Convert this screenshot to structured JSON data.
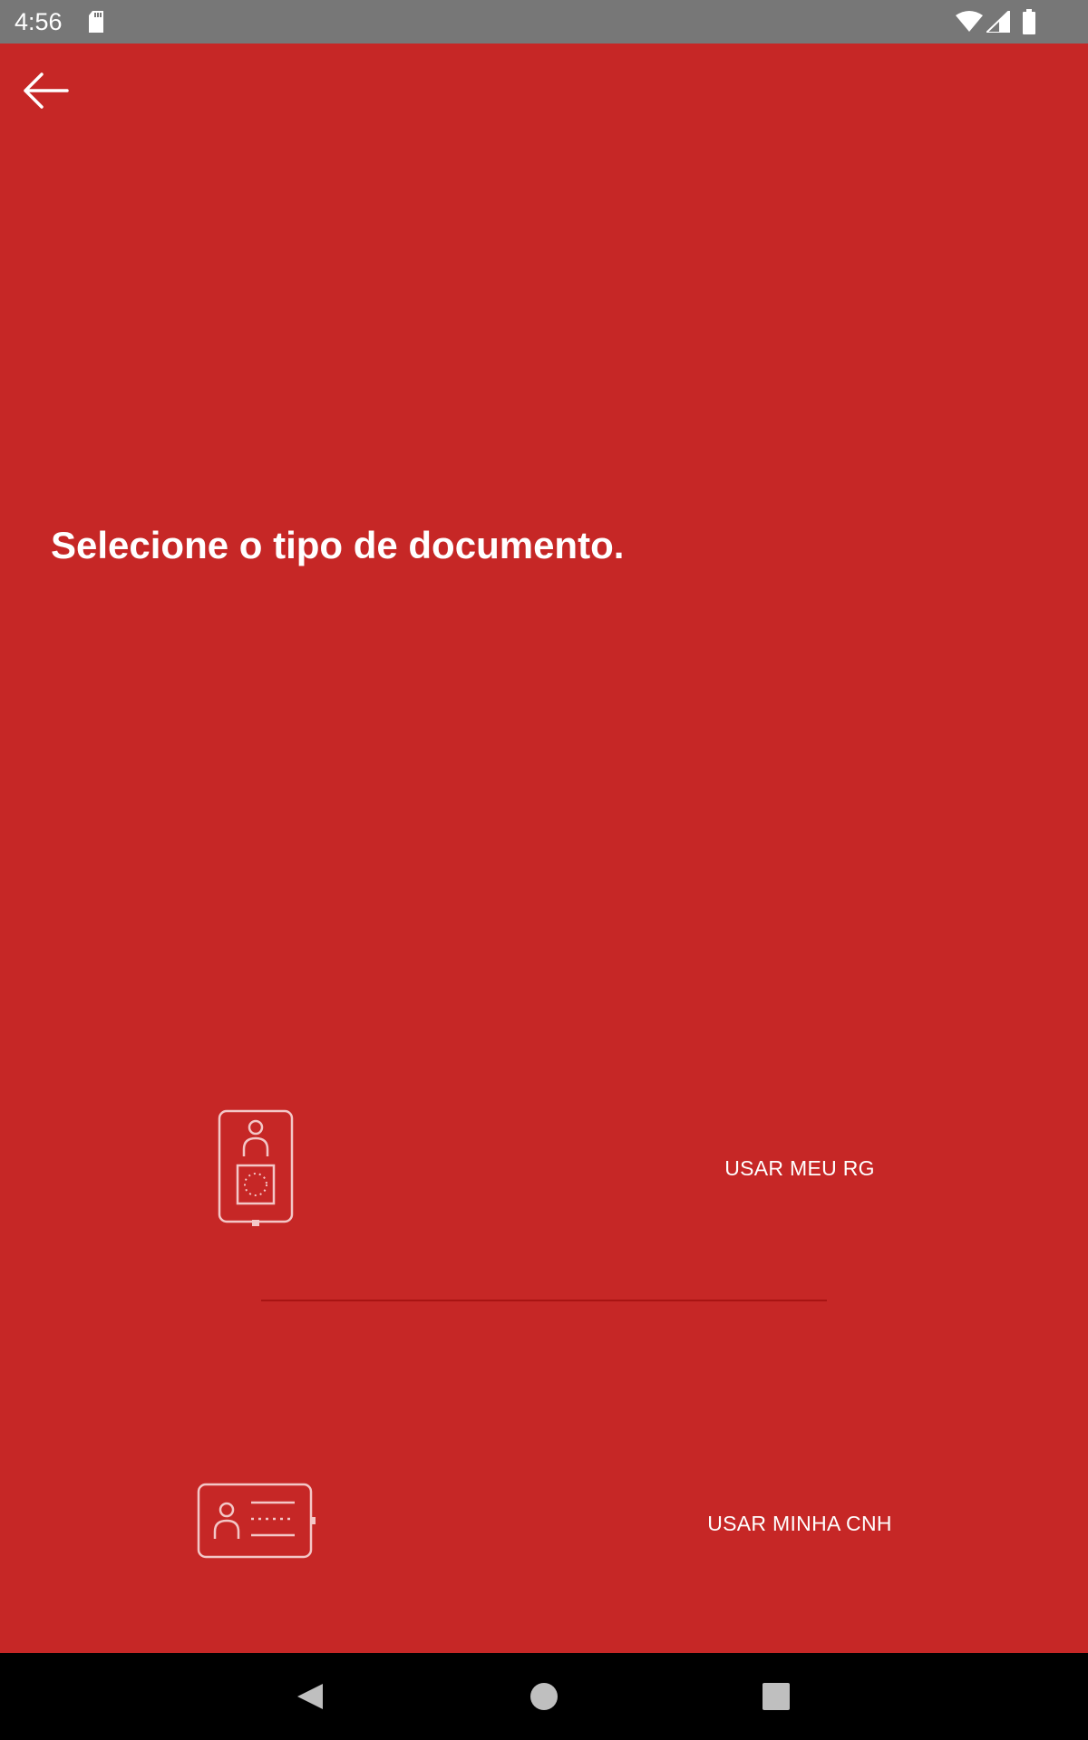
{
  "status_bar": {
    "time": "4:56",
    "icons": [
      "sd-card-icon",
      "wifi-icon",
      "signal-icon",
      "battery-icon"
    ]
  },
  "toolbar": {
    "back_icon": "arrow-left-icon"
  },
  "main": {
    "title": "Selecione o tipo de documento.",
    "options": [
      {
        "icon": "id-card-vertical-icon",
        "label": "USAR MEU RG"
      },
      {
        "icon": "driver-license-icon",
        "label": "USAR MINHA CNH"
      }
    ]
  },
  "nav_bar": {
    "buttons": [
      "nav-back-icon",
      "nav-home-icon",
      "nav-recents-icon"
    ]
  },
  "colors": {
    "background": "#c62726",
    "status_bar": "#777777",
    "divider": "#a81413",
    "nav_bar": "#000000",
    "text": "#ffffff"
  }
}
